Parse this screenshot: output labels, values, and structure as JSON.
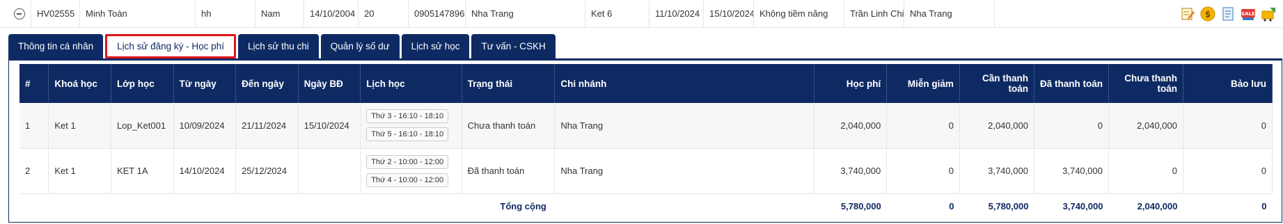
{
  "student": {
    "code": "HV02555",
    "name": "Minh Toàn",
    "nickname": "hh",
    "gender": "Nam",
    "dob": "14/10/2004",
    "age": "20",
    "phone": "0905147896",
    "address": "Nha Trang",
    "course": "Ket 6",
    "date1": "11/10/2024",
    "date2": "15/10/2024",
    "potential": "Không tiềm năng",
    "consultant": "Trần Linh Chi",
    "branch": "Nha Trang"
  },
  "actions": [
    "edit-icon",
    "coin-icon",
    "document-icon",
    "sale-icon",
    "cart-icon"
  ],
  "tabs": [
    {
      "label": "Thông tin cá nhân"
    },
    {
      "label": "Lịch sử đăng ký - Học phí"
    },
    {
      "label": "Lịch sử thu chi"
    },
    {
      "label": "Quản lý số dư"
    },
    {
      "label": "Lịch sử học"
    },
    {
      "label": "Tư vấn - CSKH"
    }
  ],
  "table": {
    "headers": {
      "idx": "#",
      "course": "Khoá học",
      "class": "Lớp học",
      "from": "Từ ngày",
      "to": "Đến ngày",
      "start": "Ngày BĐ",
      "schedule": "Lịch học",
      "status": "Trạng thái",
      "branch": "Chi nhánh",
      "fee": "Học phí",
      "discount": "Miễn giảm",
      "need_pay": "Cần thanh toán",
      "paid": "Đã thanh toán",
      "unpaid": "Chưa thanh toán",
      "reserve": "Bảo lưu"
    },
    "rows": [
      {
        "idx": "1",
        "course": "Ket 1",
        "class": "Lop_Ket001",
        "from": "10/09/2024",
        "to": "21/11/2024",
        "start": "15/10/2024",
        "schedule": [
          "Thứ 3 - 16:10 - 18:10",
          "Thứ 5 - 16:10 - 18:10"
        ],
        "status": "Chưa thanh toán",
        "branch": "Nha Trang",
        "fee": "2,040,000",
        "discount": "0",
        "need_pay": "2,040,000",
        "paid": "0",
        "unpaid": "2,040,000",
        "reserve": "0"
      },
      {
        "idx": "2",
        "course": "Ket 1",
        "class": "KET 1A",
        "from": "14/10/2024",
        "to": "25/12/2024",
        "start": "",
        "schedule": [
          "Thứ 2 - 10:00 - 12:00",
          "Thứ 4 - 10:00 - 12:00"
        ],
        "status": "Đã thanh toán",
        "branch": "Nha Trang",
        "fee": "3,740,000",
        "discount": "0",
        "need_pay": "3,740,000",
        "paid": "3,740,000",
        "unpaid": "0",
        "reserve": "0"
      }
    ],
    "total": {
      "label": "Tổng cộng",
      "fee": "5,780,000",
      "discount": "0",
      "need_pay": "5,780,000",
      "paid": "3,740,000",
      "unpaid": "2,040,000",
      "reserve": "0"
    }
  },
  "colors": {
    "navy": "#0e2a63",
    "active_border": "#e0141b",
    "unpaid_text": "#c0392b"
  }
}
